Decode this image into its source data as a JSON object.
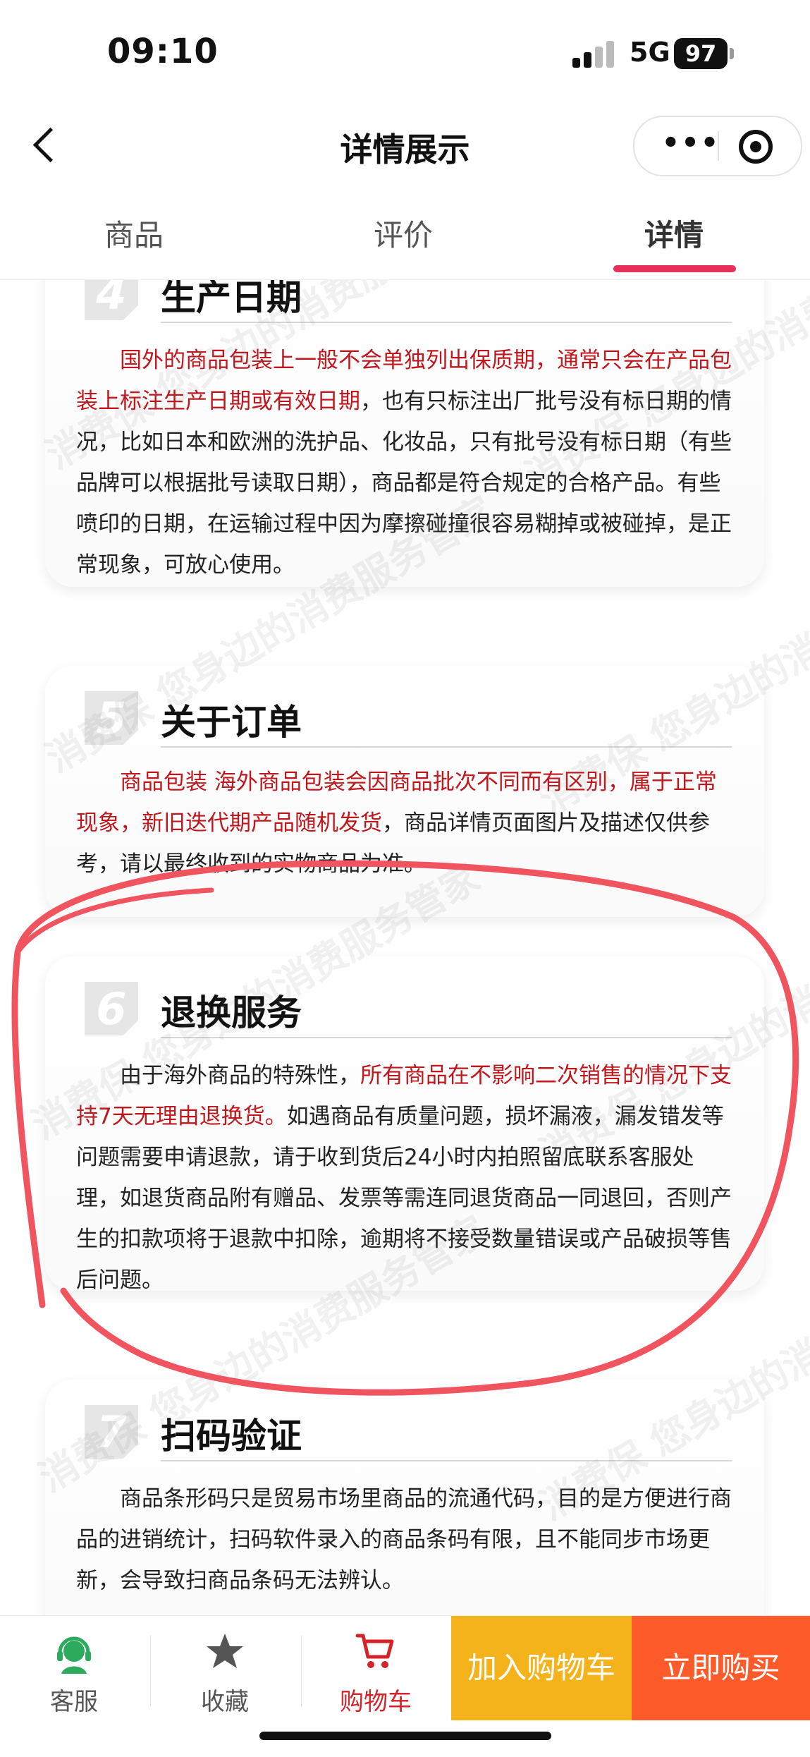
{
  "status_bar": {
    "time": "09:10",
    "network": "5G",
    "battery": "97"
  },
  "nav": {
    "title": "详情展示",
    "more_icon": "more-dots-icon",
    "close_icon": "target-circle-icon"
  },
  "tabs": [
    {
      "label": "商品"
    },
    {
      "label": "评价"
    },
    {
      "label": "详情",
      "active": true
    }
  ],
  "sections": [
    {
      "number": "4",
      "title": "生产日期",
      "body_hl": "国外的商品包装上一般不会单独列出保质期，通常只会在产品包装上标注生产日期或有效日期",
      "body": "，也有只标注出厂批号没有标日期的情况，比如日本和欧洲的洗护品、化妆品，只有批号没有标日期（有些品牌可以根据批号读取日期），商品都是符合规定的合格产品。有些喷印的日期，在运输过程中因为摩擦碰撞很容易糊掉或被碰掉，是正常现象，可放心使用。"
    },
    {
      "number": "5",
      "title": "关于订单",
      "body_hl": "商品包装 海外商品包装会因商品批次不同而有区别，属于正常现象，新旧迭代期产品随机发货",
      "body": "，商品详情页面图片及描述仅供参考，请以最终收到的实物商品为准。"
    },
    {
      "number": "6",
      "title": "退换服务",
      "body_pre": "由于海外商品的特殊性，",
      "body_hl": "所有商品在不影响二次销售的情况下支持7天无理由退换货。",
      "body": "如遇商品有质量问题，损坏漏液，漏发错发等问题需要申请退款，请于收到货后24小时内拍照留底联系客服处理，如退货商品附有赠品、发票等需连同退货商品一同退回，否则产生的扣款项将于退款中扣除，逾期将不接受数量错误或产品破损等售后问题。"
    },
    {
      "number": "7",
      "title": "扫码验证",
      "body": "商品条形码只是贸易市场里商品的流通代码，目的是方便进行商品的进销统计，扫码软件录入的商品条码有限，且不能同步市场更新，会导致扫商品条码无法辨认。"
    }
  ],
  "watermark": "消费保 您身边的消费服务管家",
  "bottom_bar": {
    "service": {
      "label": "客服",
      "icon": "customer-service-icon"
    },
    "favorite": {
      "label": "收藏",
      "icon": "star-icon"
    },
    "cart": {
      "label": "购物车",
      "icon": "cart-icon"
    },
    "add_to_cart": "加入购物车",
    "buy_now": "立即购买"
  },
  "colors": {
    "accent": "#e8315a",
    "highlight_text": "#c0161c",
    "cart_button": "#f5b31b",
    "buy_button": "#ff5a2a",
    "annotation": "#f0555f"
  }
}
